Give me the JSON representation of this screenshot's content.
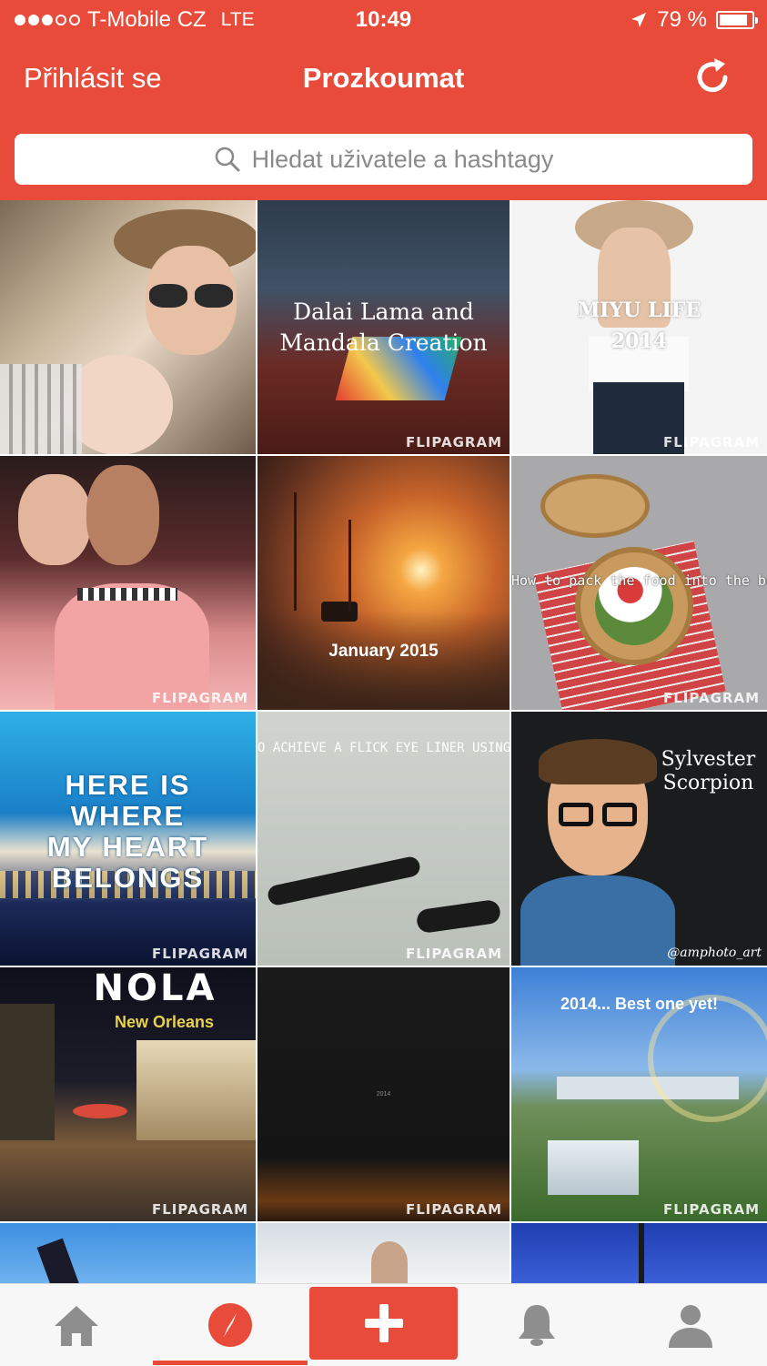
{
  "status_bar": {
    "carrier": "T-Mobile CZ",
    "network": "LTE",
    "time": "10:49",
    "battery": "79 %",
    "battery_level": 0.79
  },
  "nav": {
    "left_label": "Přihlásit se",
    "title": "Prozkoumat",
    "refresh_icon": "refresh-icon"
  },
  "search": {
    "placeholder": "Hledat uživatele a hashtagy",
    "icon": "search-icon"
  },
  "tiles": [
    {
      "caption": "",
      "watermark": ""
    },
    {
      "caption": "Dalai Lama and Mandala Creation",
      "watermark": "FLIPAGRAM"
    },
    {
      "caption": "MIYU LIFE 2014",
      "watermark": "FLIPAGRAM"
    },
    {
      "caption": "",
      "watermark": "FLIPAGRAM"
    },
    {
      "caption": "January 2015",
      "watermark": ""
    },
    {
      "caption": "How to pack the food into the bento box:)",
      "watermark": "FLIPAGRAM"
    },
    {
      "caption": "HERE IS WHERE MY HEART BELONGS",
      "watermark": "FLIPAGRAM"
    },
    {
      "caption": "O ACHIEVE A FLICK EYE LINER USING THE DIOR SH",
      "watermark": "FLIPAGRAM"
    },
    {
      "caption": "Sylvester Scorpion",
      "caption2": "@amphoto_art",
      "watermark": ""
    },
    {
      "caption": "NOLA",
      "caption2": "New Orleans",
      "watermark": "FLIPAGRAM"
    },
    {
      "caption": "2014",
      "watermark": "FLIPAGRAM"
    },
    {
      "caption": "2014... Best one yet!",
      "watermark": "FLIPAGRAM"
    },
    {
      "caption": "",
      "watermark": ""
    },
    {
      "caption": "",
      "watermark": ""
    },
    {
      "caption": "",
      "watermark": ""
    }
  ],
  "tabbar": {
    "items": [
      {
        "name": "home",
        "icon": "home-icon"
      },
      {
        "name": "explore",
        "icon": "compass-icon",
        "active": true
      },
      {
        "name": "create",
        "icon": "plus-icon"
      },
      {
        "name": "notifications",
        "icon": "bell-icon"
      },
      {
        "name": "profile",
        "icon": "person-icon"
      }
    ]
  },
  "colors": {
    "accent": "#e84b3a",
    "tab_inactive": "#8e8e8e"
  }
}
